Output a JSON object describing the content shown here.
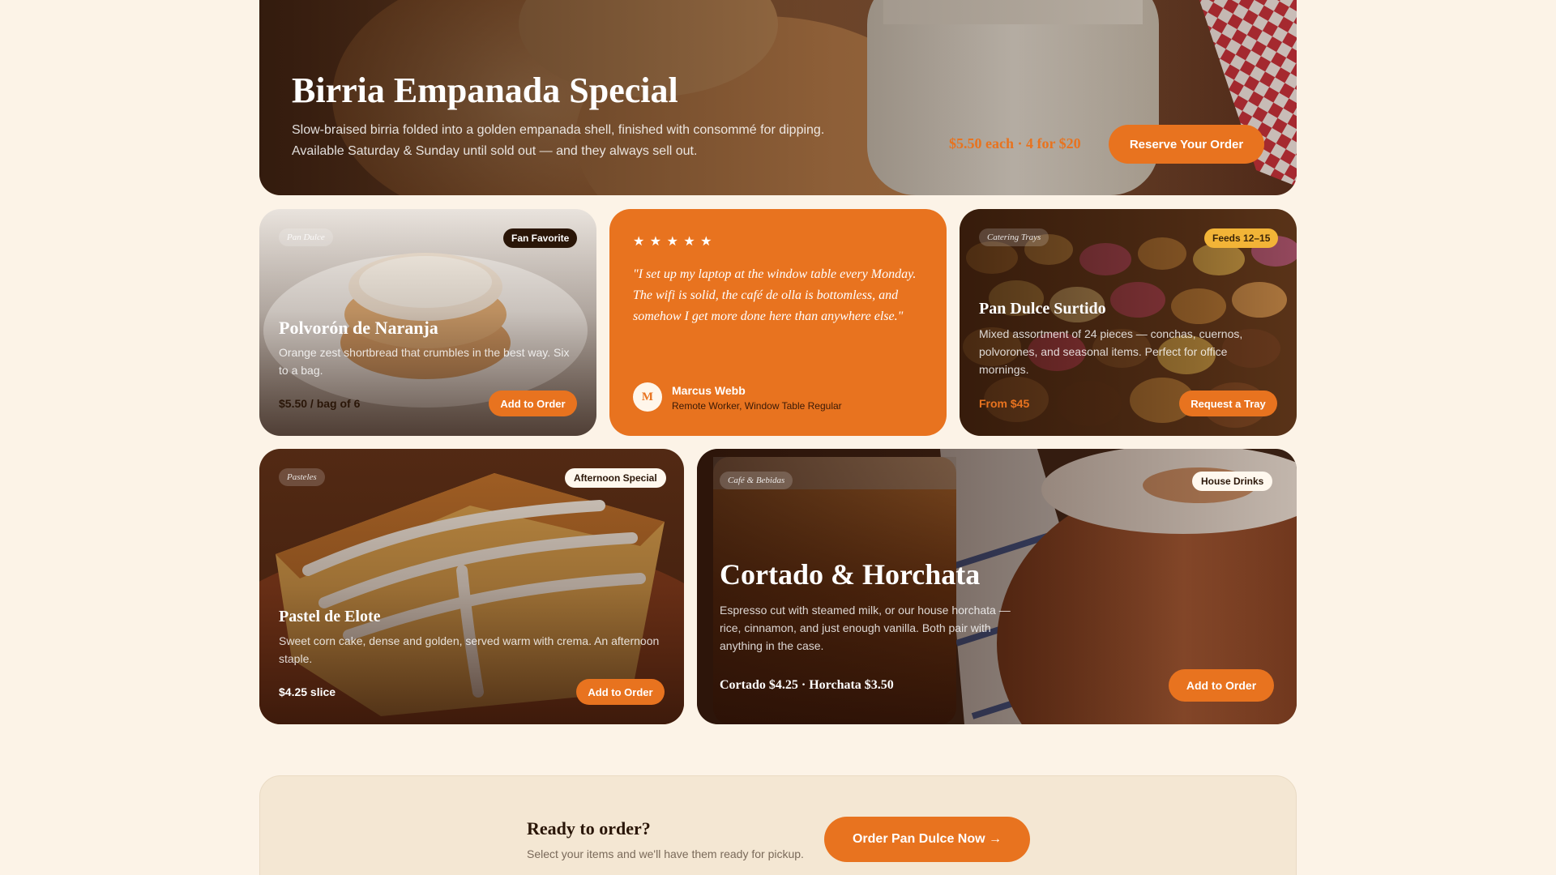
{
  "hero": {
    "title": "Birria Empanada Special",
    "desc_line1": "Slow-braised birria folded into a golden empanada shell, finished with consommé for dipping.",
    "desc_line2": "Available Saturday & Sunday until sold out — and they always sell out.",
    "price": "$5.50 each · 4 for $20",
    "button": "Reserve Your Order"
  },
  "polvoron": {
    "category": "Pan Dulce",
    "badge": "Fan Favorite",
    "title": "Polvorón de Naranja",
    "desc": "Orange zest shortbread that crumbles in the best way. Six to a bag.",
    "price": "$5.50 / bag of 6",
    "button": "Add to Order"
  },
  "testimonial": {
    "stars": "★ ★ ★ ★ ★",
    "quote": "\"I set up my laptop at the window table every Monday. The wifi is solid, the café de olla is bottomless, and somehow I get more done here than anywhere else.\"",
    "avatar_initial": "M",
    "name": "Marcus Webb",
    "role": "Remote Worker, Window Table Regular"
  },
  "surtido": {
    "category": "Catering Trays",
    "badge": "Feeds 12–15",
    "title": "Pan Dulce Surtido",
    "desc": "Mixed assortment of 24 pieces — conchas, cuernos, polvorones, and seasonal items. Perfect for office mornings.",
    "price": "From $45",
    "button": "Request a Tray"
  },
  "elote": {
    "category": "Pasteles",
    "badge": "Afternoon Special",
    "title": "Pastel de Elote",
    "desc": "Sweet corn cake, dense and golden, served warm with crema. An afternoon staple.",
    "price": "$4.25 slice",
    "button": "Add to Order"
  },
  "drinks": {
    "category": "Café & Bebidas",
    "badge": "House Drinks",
    "title": "Cortado & Horchata",
    "desc": "Espresso cut with steamed milk, or our house horchata — rice, cinnamon, and just enough vanilla. Both pair with anything in the case.",
    "price": "Cortado $4.25 · Horchata $3.50",
    "button": "Add to Order"
  },
  "cta": {
    "title": "Ready to order?",
    "subtitle": "Select your items and we'll have them ready for pickup.",
    "button": "Order Pan Dulce Now →"
  },
  "colors": {
    "accent": "#e8731f",
    "background": "#fcf3e7",
    "dark": "#2a1608",
    "gold": "#f2b437"
  }
}
